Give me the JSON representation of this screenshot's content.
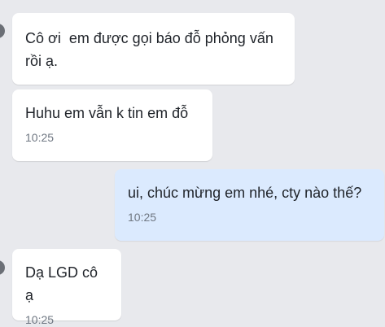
{
  "chat": {
    "messages": [
      {
        "sender": "other",
        "text": "Cô ơi  em được gọi báo đỗ phỏng vấn rồi ạ.",
        "time": ""
      },
      {
        "sender": "other",
        "text": "Huhu em vẫn k tin em đỗ",
        "time": "10:25"
      },
      {
        "sender": "self",
        "text": "ui, chúc mừng em nhé, cty nào thế?",
        "time": "10:25"
      },
      {
        "sender": "other",
        "text": "Dạ LGD cô ạ",
        "time": "10:25"
      }
    ]
  },
  "colors": {
    "background": "#e8e9ed",
    "incoming_bubble": "#ffffff",
    "outgoing_bubble": "#dbeafe",
    "timestamp": "#6f7782"
  }
}
